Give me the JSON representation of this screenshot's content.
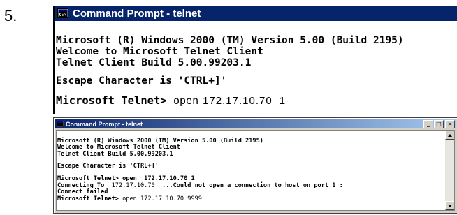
{
  "step_number": "5.",
  "large_window": {
    "title": "Command Prompt - telnet",
    "lines": [
      "Microsoft (R) Windows 2000 (TM) Version 5.00 (Build 2195)",
      "Welcome to Microsoft Telnet Client",
      "Telnet Client Build 5.00.99203.1"
    ],
    "escape_line": "Escape Character is 'CTRL+]'",
    "prompt": "Microsoft Telnet> ",
    "typed_command": "open",
    "typed_host": "172.17.10.70",
    "typed_port": "1"
  },
  "small_window": {
    "title": "Command Prompt - telnet",
    "buttons": {
      "minimize": "_",
      "maximize": "□",
      "close": "×"
    },
    "lines": [
      "Microsoft (R) Windows 2000 (TM) Version 5.00 (Build 2195)",
      "Welcome to Microsoft Telnet Client",
      "Telnet Client Build 5.00.99203.1"
    ],
    "escape_line": "Escape Character is 'CTRL+]'",
    "session": {
      "prompt1": "Microsoft Telnet> ",
      "cmd1": "open  172.17.10.70 1",
      "connecting_label": "Connecting To  ",
      "connecting_host": "172.17.10.70",
      "connecting_rest": "  ...Could not open a connection to host on port 1 :",
      "connect_failed": "Connect failed",
      "prompt2": "Microsoft Telnet> ",
      "cmd2": "open 172.17.10.70 9999"
    }
  },
  "colors": {
    "titlebar_active": "#0a246a",
    "titlebar_gradient_end": "#a6caf0",
    "window_face": "#d4d0c8",
    "console_background": "#ffffff",
    "console_text": "#000000"
  },
  "icons": [
    "command-prompt-icon",
    "minimize-icon",
    "maximize-icon",
    "close-icon",
    "scroll-up-arrow-icon",
    "scroll-down-arrow-icon"
  ]
}
